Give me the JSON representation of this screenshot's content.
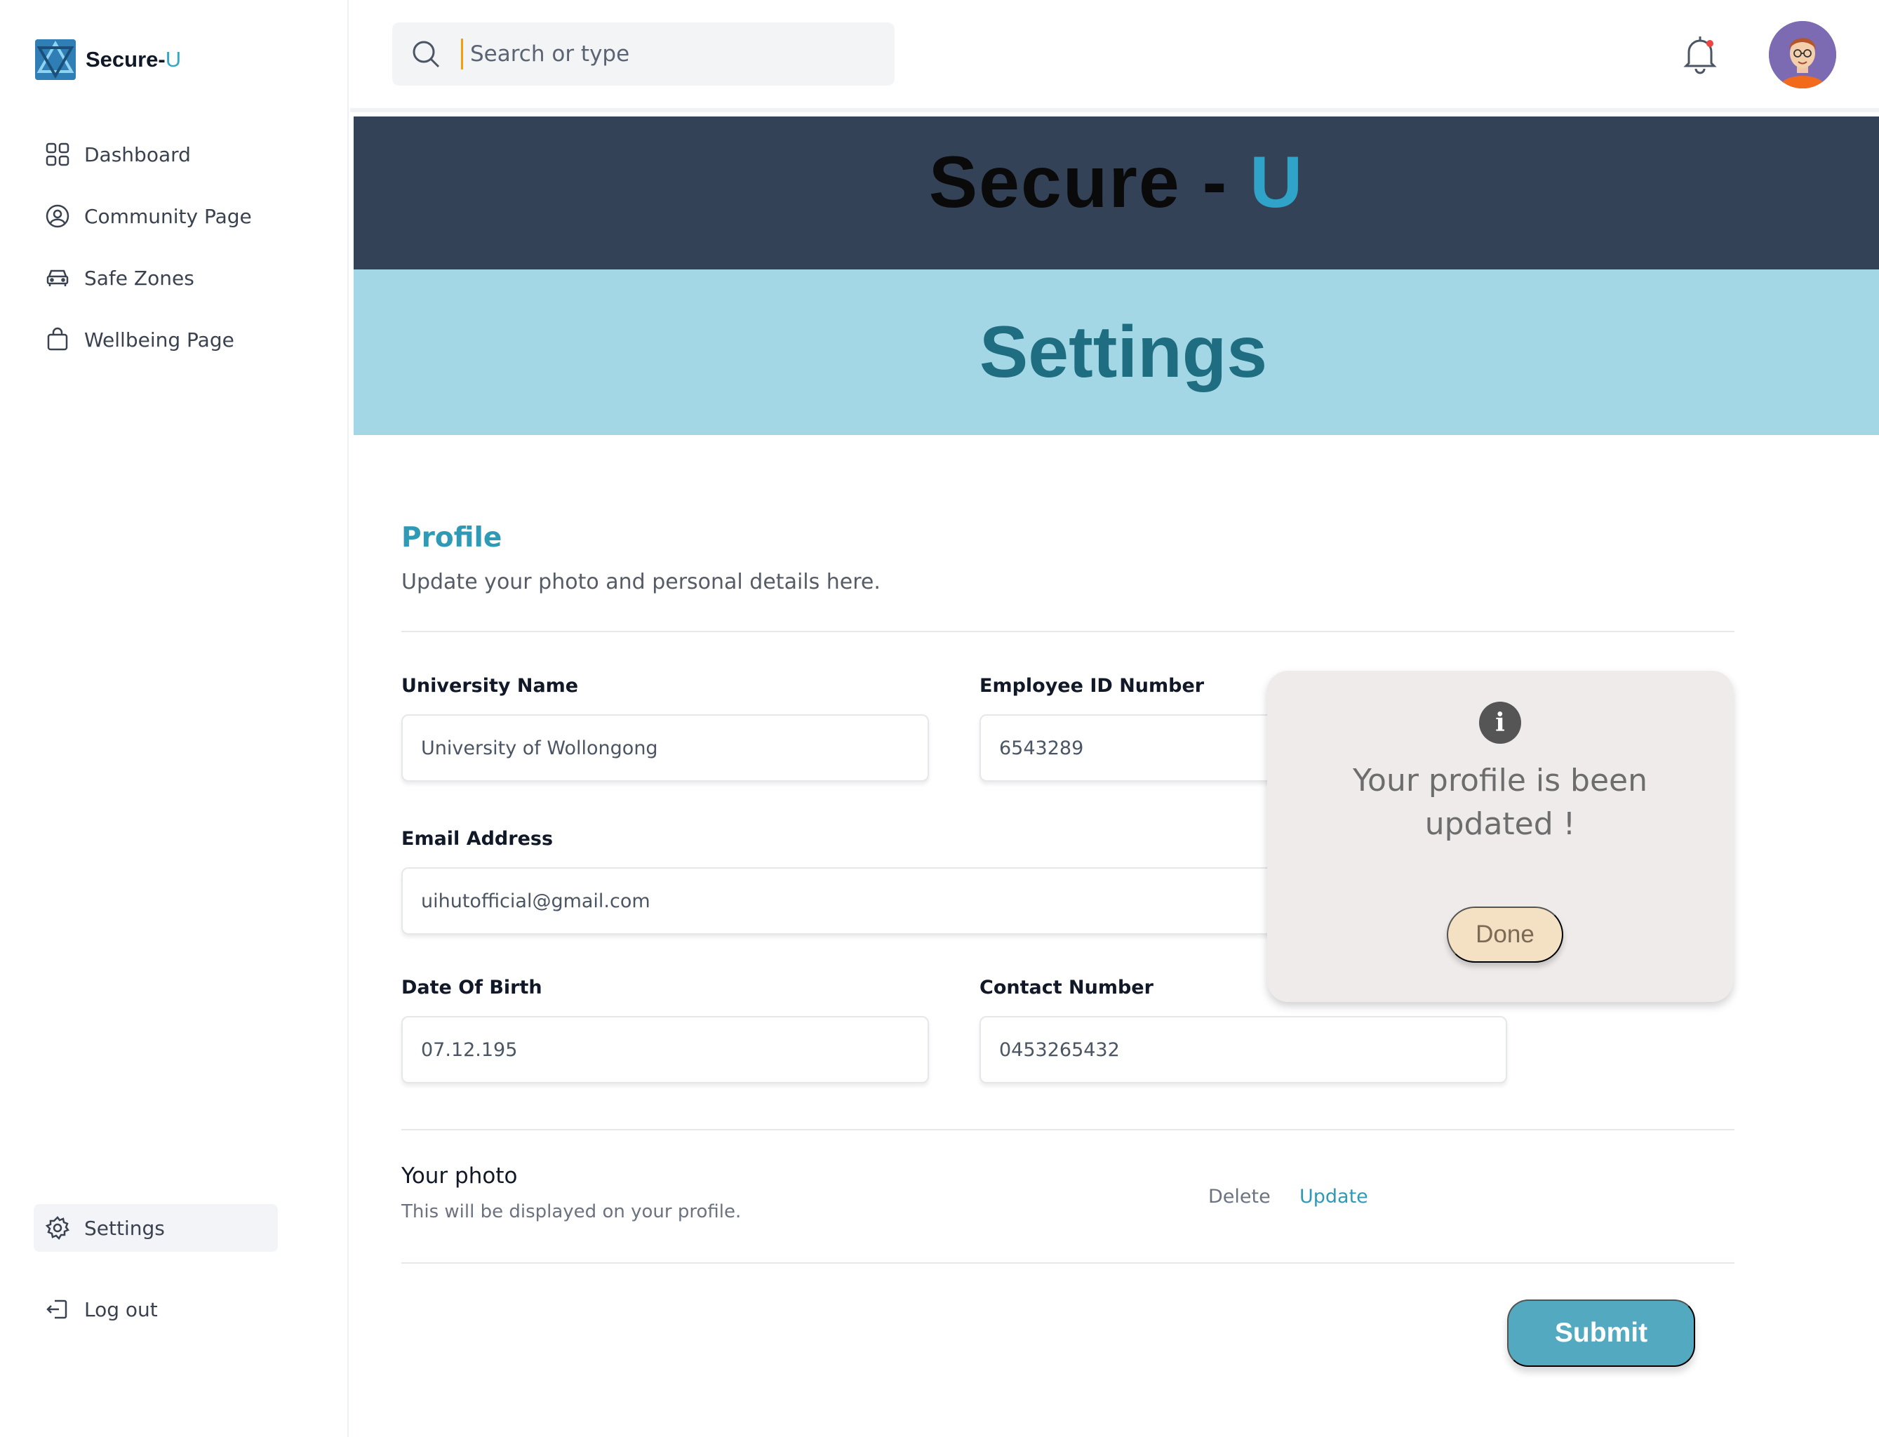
{
  "brand": {
    "name": "Secure-",
    "accent": "U"
  },
  "sidebar": {
    "items": [
      {
        "label": "Dashboard",
        "icon": "grid-icon"
      },
      {
        "label": "Community Page",
        "icon": "user-circle-icon"
      },
      {
        "label": "Safe Zones",
        "icon": "car-icon"
      },
      {
        "label": "Wellbeing Page",
        "icon": "bag-icon"
      }
    ],
    "settings_label": "Settings",
    "logout_label": "Log out"
  },
  "search": {
    "placeholder": "Search or type"
  },
  "header": {
    "app_title_main": "Secure - ",
    "app_title_accent": "U",
    "page_title": "Settings"
  },
  "profile": {
    "title": "Profile",
    "subtitle": "Update your photo and personal details here.",
    "fields": {
      "university": {
        "label": "University Name",
        "value": "University of Wollongong"
      },
      "employee_id": {
        "label": "Employee ID Number",
        "value": "6543289"
      },
      "email": {
        "label": "Email Address",
        "value": "uihutofficial@gmail.com"
      },
      "dob": {
        "label": "Date Of Birth",
        "value": "07.12.195"
      },
      "contact": {
        "label": "Contact Number",
        "value": "0453265432"
      }
    },
    "photo": {
      "title": "Your photo",
      "subtitle": "This will be displayed on your profile.",
      "delete_label": "Delete",
      "update_label": "Update"
    },
    "submit_label": "Submit"
  },
  "toast": {
    "icon": "i",
    "message": "Your profile is been updated !",
    "done_label": "Done"
  },
  "colors": {
    "accent": "#2f9ab5",
    "banner_dark": "#334256",
    "banner_light": "#a3d7e5",
    "submit": "#53a9c0",
    "done": "#f4e0c2"
  }
}
